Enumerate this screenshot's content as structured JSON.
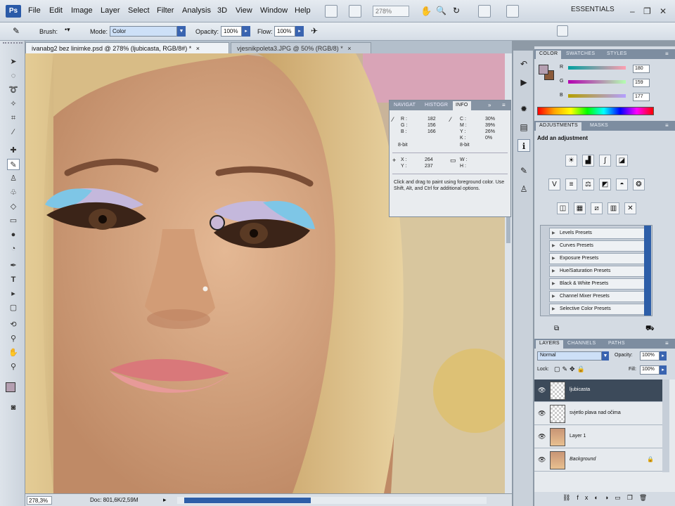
{
  "app": {
    "logo": "Ps"
  },
  "menu": [
    "File",
    "Edit",
    "Image",
    "Layer",
    "Select",
    "Filter",
    "Analysis",
    "3D",
    "View",
    "Window",
    "Help"
  ],
  "zoom": "278%",
  "workspace": "ESSENTIALS",
  "options": {
    "brush_label": "Brush:",
    "mode_label": "Mode:",
    "mode_value": "Color",
    "opacity_label": "Opacity:",
    "opacity_value": "100%",
    "flow_label": "Flow:",
    "flow_value": "100%"
  },
  "tabs": [
    {
      "label": "ivanabg2 bez linimke.psd @ 278% (ljubicasta, RGB/8#) *",
      "close": "×"
    },
    {
      "label": "vjesnikpoleta3.JPG @ 50% (RGB/8) *",
      "close": "×"
    }
  ],
  "info_panel": {
    "tabs": [
      "NAVIGAT",
      "HISTOGR",
      "INFO"
    ],
    "rgb_labels": [
      "R :",
      "G :",
      "B :"
    ],
    "rgb_values": [
      "182",
      "156",
      "166"
    ],
    "cmyk_labels": [
      "C :",
      "M :",
      "Y :",
      "K :"
    ],
    "cmyk_values": [
      "30%",
      "39%",
      "26%",
      "0%"
    ],
    "bit_left": "8-bit",
    "bit_right": "8-bit",
    "xy_labels": [
      "X :",
      "Y :"
    ],
    "xy_values": [
      "264",
      "237"
    ],
    "wh_labels": [
      "W :",
      "H :"
    ],
    "help": "Click and drag to paint using foreground color.  Use Shift, Alt, and Ctrl for additional options."
  },
  "color_panel": {
    "tabs": [
      "COLOR",
      "SWATCHES",
      "STYLES"
    ],
    "channels": [
      {
        "label": "R",
        "value": "180"
      },
      {
        "label": "G",
        "value": "159"
      },
      {
        "label": "B",
        "value": "177"
      }
    ],
    "foreground": "#b49fb1",
    "background": "#8a5a3a"
  },
  "adjustments_panel": {
    "tabs": [
      "ADJUSTMENTS",
      "MASKS"
    ],
    "heading": "Add an adjustment",
    "presets": [
      "Levels Presets",
      "Curves Presets",
      "Exposure Presets",
      "Hue/Saturation Presets",
      "Black & White Presets",
      "Channel Mixer Presets",
      "Selective Color Presets"
    ]
  },
  "layers_panel": {
    "tabs": [
      "LAYERS",
      "CHANNELS",
      "PATHS"
    ],
    "blend_mode": "Normal",
    "opacity_label": "Opacity:",
    "opacity_value": "100%",
    "lock_label": "Lock:",
    "fill_label": "Fill:",
    "fill_value": "100%",
    "layers": [
      {
        "name": "ljubicasta",
        "selected": true
      },
      {
        "name": "svjetlo plava nad očima",
        "selected": false
      },
      {
        "name": "Layer 1",
        "selected": false
      },
      {
        "name": "Background",
        "selected": false
      }
    ]
  },
  "status": {
    "zoom": "278,3%",
    "doc": "Doc: 801,6K/2,59M"
  }
}
